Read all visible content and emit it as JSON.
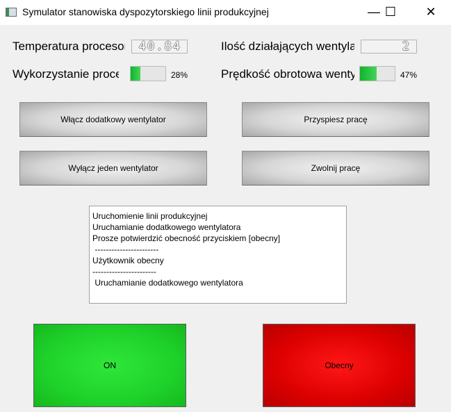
{
  "window": {
    "title": "Symulator stanowiska dyspozytorskiego linii produkcyjnej",
    "minimize_glyph": "—",
    "maximize_glyph": "☐",
    "close_glyph": "✕"
  },
  "metrics": {
    "cpu_temperature_label": "Temperatura procesora",
    "cpu_temperature_value": "40.84",
    "active_fans_label": "Ilość działających wentylatorów",
    "active_fans_value": "2",
    "cpu_usage_label": "Wykorzystanie procesora",
    "cpu_usage_percent": 28,
    "cpu_usage_text": "28%",
    "fan_speed_label": "Prędkość obrotowa wentylatorów",
    "fan_speed_percent": 47,
    "fan_speed_text": "47%"
  },
  "buttons": {
    "enable_fan": "Włącz dodatkowy wentylator",
    "speed_up": "Przyspiesz pracę",
    "disable_fan": "Wyłącz jeden wentylator",
    "slow_down": "Zwolnij pracę"
  },
  "log": {
    "lines": [
      "Uruchomienie linii produkcyjnej",
      "Uruchamianie dodatkowego wentylatora",
      "Prosze potwierdzić obecność przyciskiem [obecny]",
      " -----------------------",
      "Użytkownik obecny",
      "-----------------------",
      " Uruchamianie dodatkowego wentylatora"
    ]
  },
  "status": {
    "on_label": "ON",
    "on_color": "#22d62d",
    "presence_label": "Obecny",
    "presence_color": "#e00000"
  }
}
